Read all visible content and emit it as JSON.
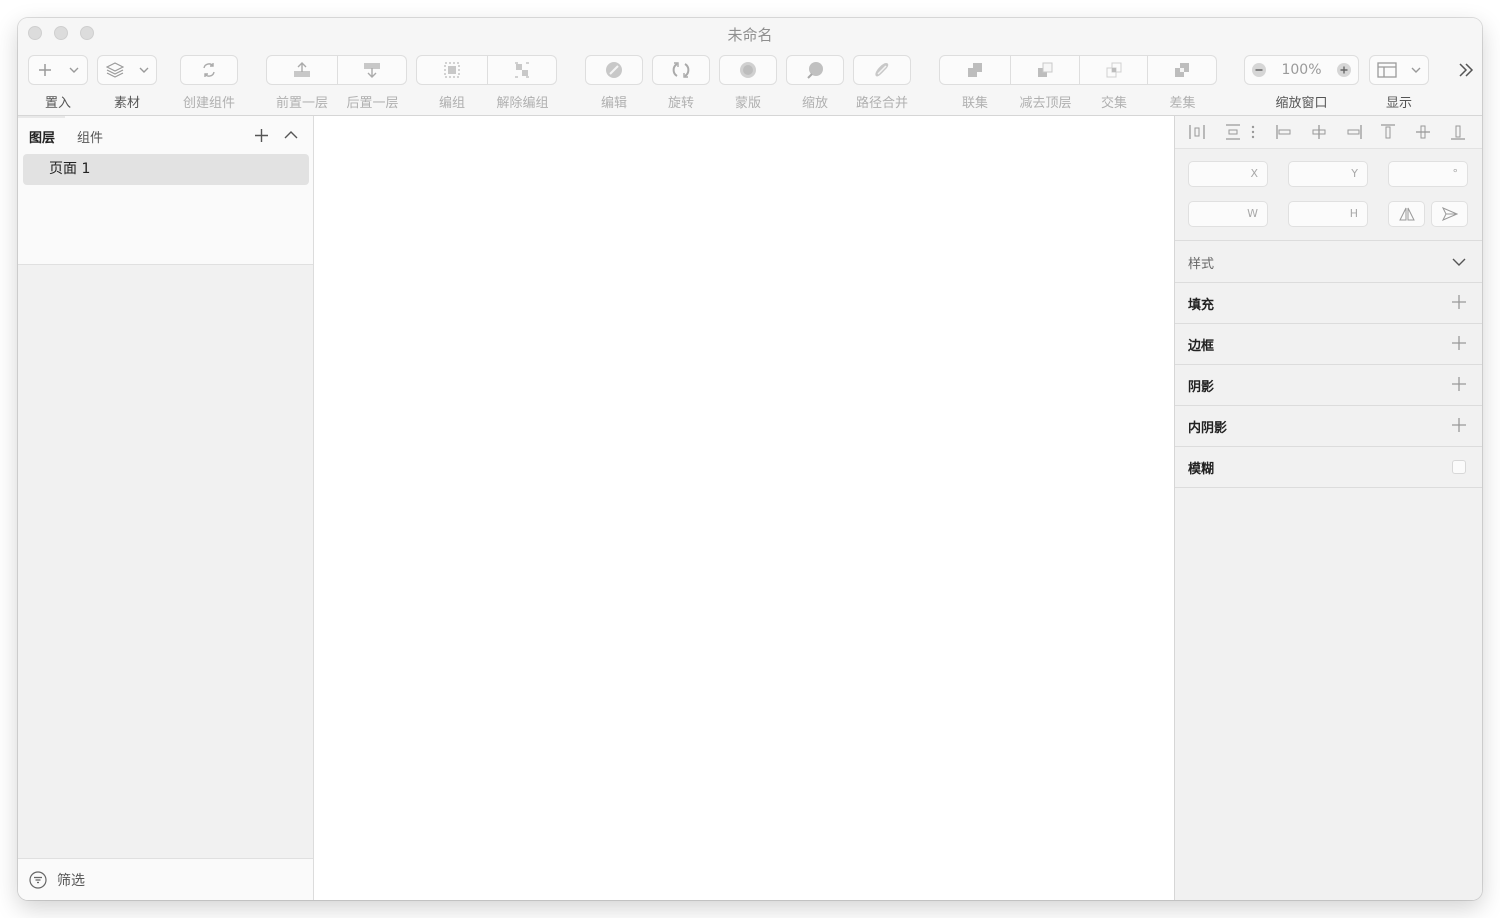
{
  "window": {
    "title": "未命名"
  },
  "toolbar": {
    "insert": "置入",
    "assets": "素材",
    "create_component": "创建组件",
    "bring_forward": "前置一层",
    "send_backward": "后置一层",
    "group": "编组",
    "ungroup": "解除编组",
    "edit": "编辑",
    "rotate": "旋转",
    "mask": "蒙版",
    "scale": "缩放",
    "path_combine": "路径合并",
    "union": "联集",
    "subtract": "减去顶层",
    "intersect": "交集",
    "difference": "差集",
    "zoom_window": "缩放窗口",
    "zoom_value": "100%",
    "display": "显示"
  },
  "left_panel": {
    "tabs": [
      "图层",
      "组件"
    ],
    "pages": [
      "页面 1"
    ],
    "filter_label": "筛选"
  },
  "right_panel": {
    "fields": {
      "x": "X",
      "y": "Y",
      "rotation": "°",
      "w": "W",
      "h": "H"
    },
    "sections": {
      "style": "样式",
      "fill": "填充",
      "border": "边框",
      "shadow": "阴影",
      "inner_shadow": "内阴影",
      "blur": "模糊"
    }
  },
  "icons": {
    "plus": "plus-icon",
    "chevron": "chevron-down-icon",
    "layers": "layers-icon",
    "refresh": "refresh-icon",
    "more": "double-chevron-right-icon"
  }
}
